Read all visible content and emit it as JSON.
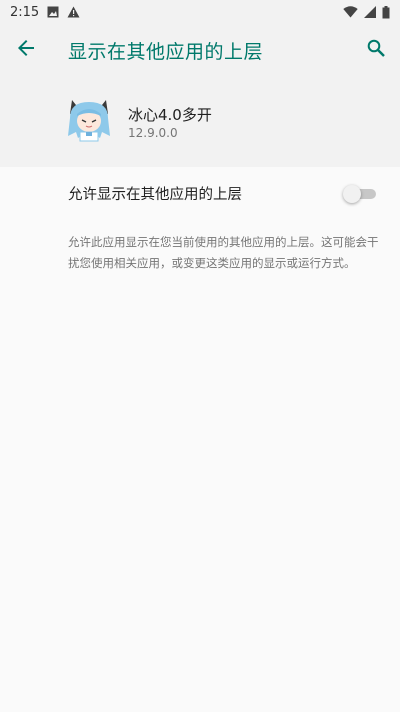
{
  "status_bar": {
    "time": "2:15",
    "icons": [
      "image-icon",
      "warning-icon",
      "wifi-icon",
      "signal-icon",
      "battery-icon"
    ]
  },
  "app_bar": {
    "title": "显示在其他应用的上层",
    "back_icon": "arrow-back-icon",
    "search_icon": "search-icon",
    "accent_color": "#00796b"
  },
  "app_info": {
    "name": "冰心4.0多开",
    "version": "12.9.0.0",
    "icon": "anime-character-icon"
  },
  "setting": {
    "label": "允许显示在其他应用的上层",
    "enabled": false
  },
  "description": "允许此应用显示在您当前使用的其他应用的上层。这可能会干扰您使用相关应用，或变更这类应用的显示或运行方式。"
}
